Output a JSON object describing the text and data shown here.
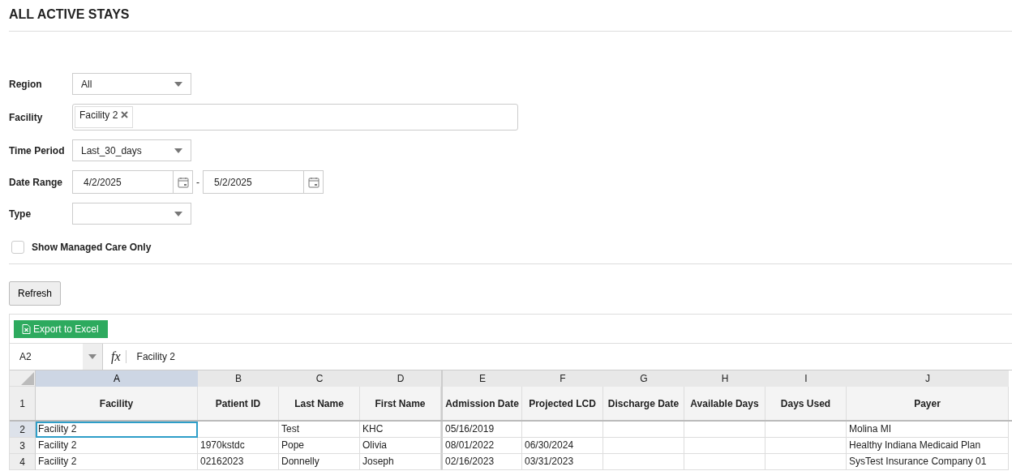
{
  "title": "ALL ACTIVE STAYS",
  "filters": [
    {
      "label": "Region",
      "kind": "select",
      "value": "All"
    },
    {
      "label": "Facility",
      "kind": "tags",
      "tags": [
        "Facility 2"
      ]
    },
    {
      "label": "Time Period",
      "kind": "select",
      "value": "Last_30_days"
    },
    {
      "label": "Date Range",
      "kind": "daterange",
      "from": "4/2/2025",
      "separator": "-",
      "to": "5/2/2025"
    },
    {
      "label": "Type",
      "kind": "select"
    }
  ],
  "managed_care": {
    "label": "Show Managed Care Only",
    "checked": false
  },
  "refresh_button": "Refresh",
  "export_button": "Export to Excel",
  "formula_bar": {
    "cell_ref": "A2",
    "fx": "fx",
    "value": "Facility 2"
  },
  "grid": {
    "columns": [
      {
        "letter": "A",
        "header": "Facility",
        "selected": true
      },
      {
        "letter": "B",
        "header": "Patient ID",
        "selected": false
      },
      {
        "letter": "C",
        "header": "Last Name",
        "selected": false
      },
      {
        "letter": "D",
        "header": "First Name",
        "selected": false
      },
      {
        "letter": "E",
        "header": "Admission Date",
        "selected": false
      },
      {
        "letter": "F",
        "header": "Projected LCD",
        "selected": false
      },
      {
        "letter": "G",
        "header": "Discharge Date",
        "selected": false
      },
      {
        "letter": "H",
        "header": "Available Days",
        "selected": false
      },
      {
        "letter": "I",
        "header": "Days Used",
        "selected": false
      },
      {
        "letter": "J",
        "header": "Payer",
        "selected": false
      }
    ],
    "header_row_number": "1",
    "rows": [
      {
        "number": "2",
        "selected": true,
        "cells": [
          "Facility 2",
          "",
          "Test",
          "KHC",
          "05/16/2019",
          "",
          "",
          "",
          "",
          "Molina MI"
        ]
      },
      {
        "number": "3",
        "selected": false,
        "cells": [
          "Facility 2",
          "1970kstdc",
          "Pope",
          "Olivia",
          "08/01/2022",
          "06/30/2024",
          "",
          "",
          "",
          "Healthy Indiana Medicaid Plan"
        ]
      },
      {
        "number": "4",
        "selected": false,
        "cells": [
          "Facility 2",
          "02162023",
          "Donnelly",
          "Joseph",
          "02/16/2023",
          "03/31/2023",
          "",
          "",
          "",
          "SysTest Insurance Company 01"
        ]
      }
    ]
  }
}
